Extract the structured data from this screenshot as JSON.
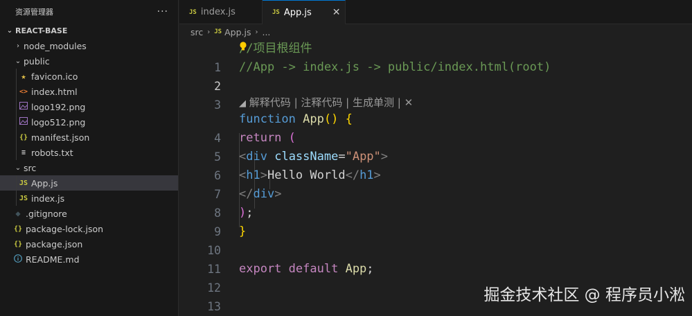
{
  "sidebar": {
    "title": "资源管理器",
    "more": "···",
    "section": "REACT-BASE",
    "items": [
      {
        "label": "node_modules",
        "type": "folder",
        "icon": "chevron-right-icon"
      },
      {
        "label": "public",
        "type": "folder",
        "icon": "chevron-down-icon"
      },
      {
        "label": "favicon.ico",
        "icon": "star-icon"
      },
      {
        "label": "index.html",
        "icon": "html-icon"
      },
      {
        "label": "logo192.png",
        "icon": "image-icon"
      },
      {
        "label": "logo512.png",
        "icon": "image-icon"
      },
      {
        "label": "manifest.json",
        "icon": "json-icon"
      },
      {
        "label": "robots.txt",
        "icon": "text-file-icon"
      },
      {
        "label": "src",
        "type": "folder",
        "icon": "chevron-down-icon"
      },
      {
        "label": "App.js",
        "icon": "js-icon",
        "selected": true
      },
      {
        "label": "index.js",
        "icon": "js-icon"
      },
      {
        "label": ".gitignore",
        "icon": "git-icon"
      },
      {
        "label": "package-lock.json",
        "icon": "json-icon"
      },
      {
        "label": "package.json",
        "icon": "json-icon"
      },
      {
        "label": "README.md",
        "icon": "info-icon"
      }
    ]
  },
  "tabs": [
    {
      "label": "index.js",
      "badge": "JS",
      "active": false
    },
    {
      "label": "App.js",
      "badge": "JS",
      "active": true,
      "close": "✕"
    }
  ],
  "breadcrumb": {
    "folder": "src",
    "badge": "JS",
    "file": "App.js",
    "more": "..."
  },
  "editor": {
    "line_numbers": [
      "1",
      "2",
      "3",
      "4",
      "5",
      "6",
      "7",
      "8",
      "9",
      "10",
      "11",
      "12",
      "13"
    ],
    "active_line": "2",
    "codelens": {
      "explain": "解释代码",
      "comment": "注释代码",
      "test": "生成单测",
      "sep": " | ",
      "close": "✕"
    },
    "code": {
      "l1": "//项目根组件",
      "l2": "//App -> index.js -> public/index.html(root)",
      "l4_kw": "function",
      "l4_fn": "App",
      "l5_kw": "return",
      "l6_tag": "div",
      "l6_attr": "className",
      "l6_str": "\"App\"",
      "l7_tag": "h1",
      "l7_text": "Hello World",
      "l8_tag": "div",
      "l12_kw1": "export",
      "l12_kw2": "default",
      "l12_name": "App"
    }
  },
  "watermark": "掘金技术社区 @ 程序员小淞",
  "colors": {
    "background": "#1f1f1f",
    "sidebar": "#181818",
    "accent": "#0078d4",
    "comment": "#6a9955",
    "keyword": "#569cd6",
    "control": "#c586c0",
    "function": "#dcdcaa",
    "string": "#ce9178"
  }
}
